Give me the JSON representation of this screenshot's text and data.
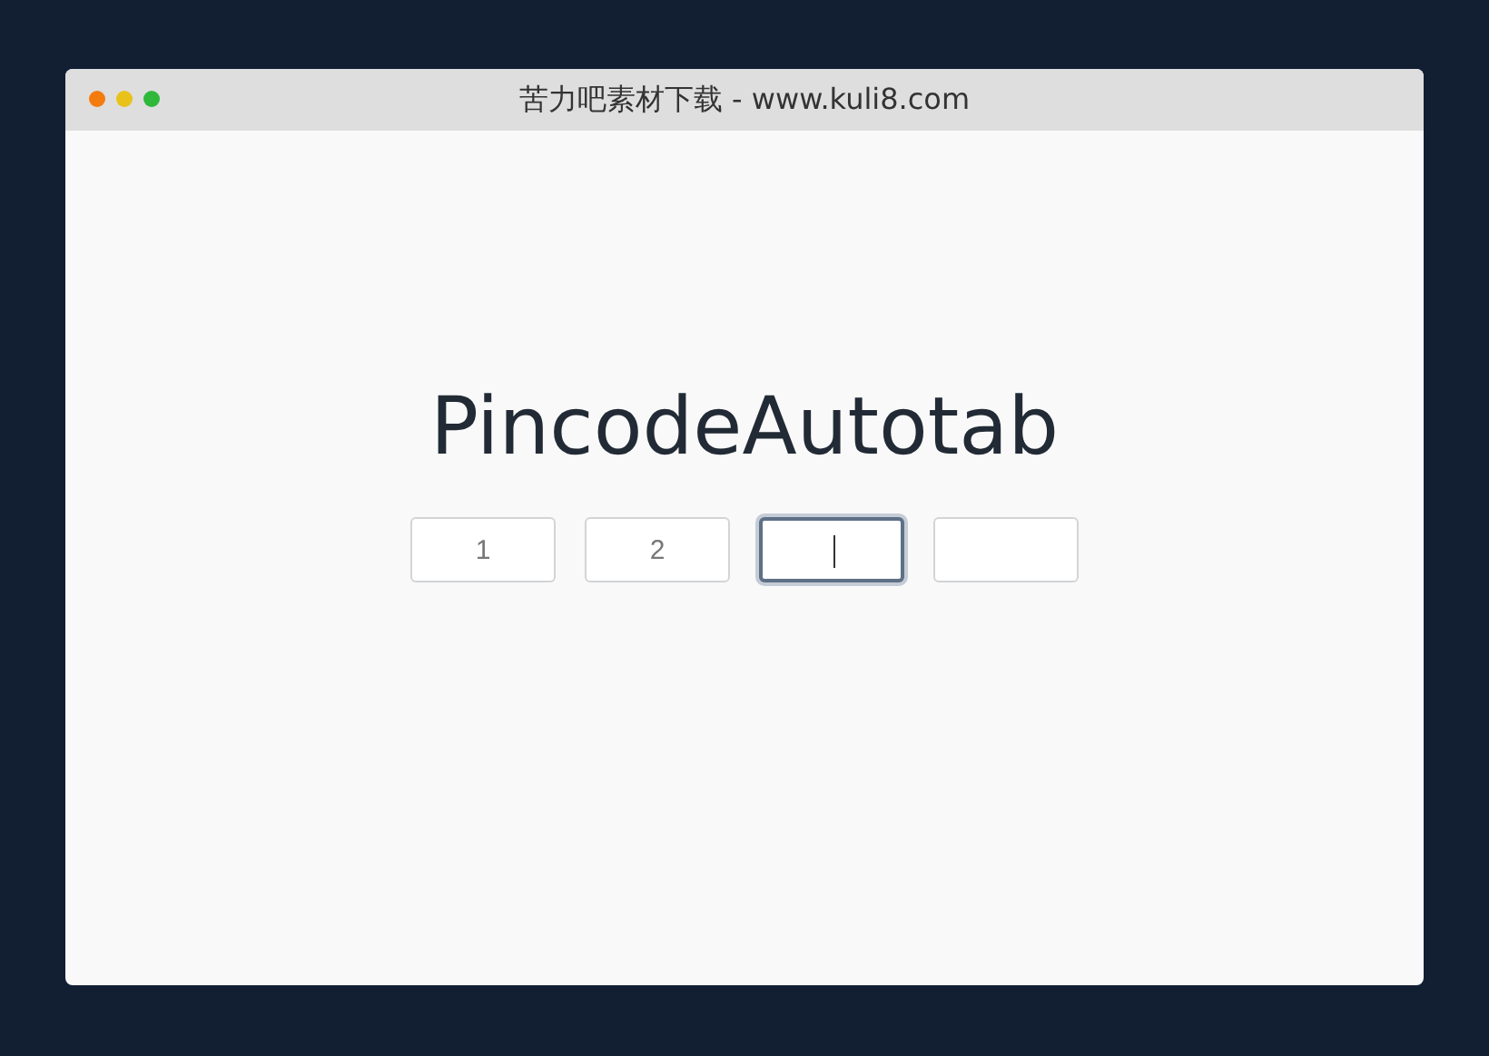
{
  "window": {
    "title": "苦力吧素材下载 - www.kuli8.com"
  },
  "heading": "PincodeAutotab",
  "pins": [
    {
      "value": "1",
      "selected": false
    },
    {
      "value": "2",
      "selected": false
    },
    {
      "selected": true
    },
    {
      "selected": false
    }
  ]
}
